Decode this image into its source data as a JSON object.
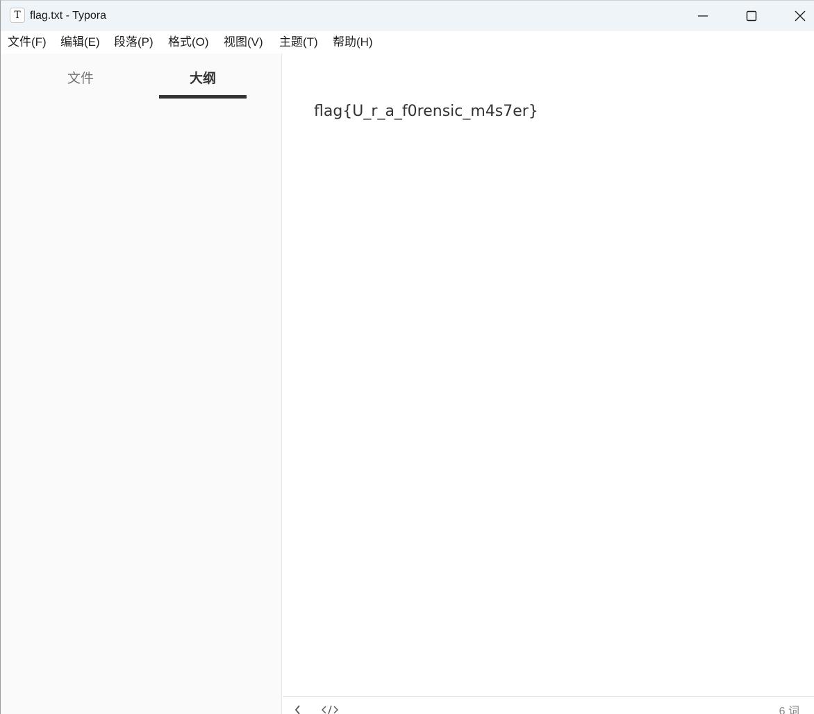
{
  "window": {
    "title": "flag.txt - Typora",
    "app_icon_glyph": "T",
    "controls": [
      "minimize-icon",
      "maximize-icon",
      "close-icon"
    ]
  },
  "menubar": {
    "items": [
      {
        "label": "文件(F)"
      },
      {
        "label": "编辑(E)"
      },
      {
        "label": "段落(P)"
      },
      {
        "label": "格式(O)"
      },
      {
        "label": "视图(V)"
      },
      {
        "label": "主题(T)"
      },
      {
        "label": "帮助(H)"
      }
    ]
  },
  "sidebar": {
    "tabs": [
      {
        "label": "文件",
        "active": false
      },
      {
        "label": "大纲",
        "active": true
      }
    ]
  },
  "editor": {
    "content": "flag{U_r_a_f0rensic_m4s7er}"
  },
  "statusbar": {
    "icons": [
      "chevron-left-icon",
      "source-code-icon"
    ],
    "word_count": "6 词"
  }
}
